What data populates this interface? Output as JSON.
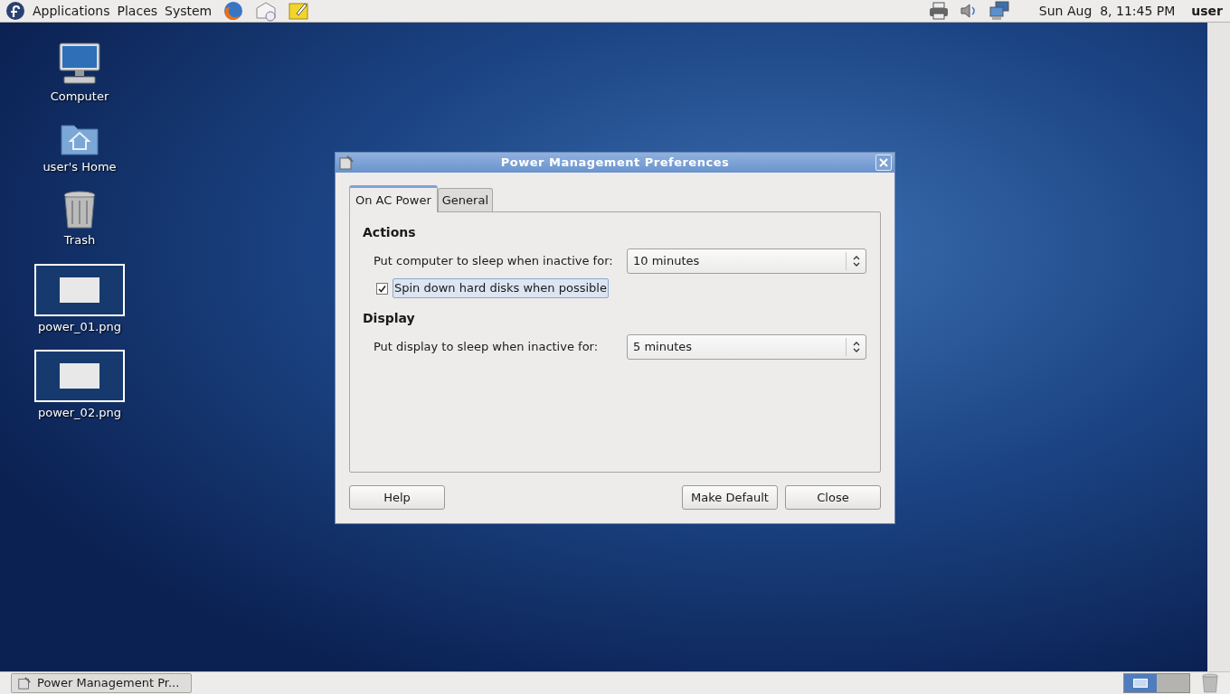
{
  "top_panel": {
    "menus": [
      "Applications",
      "Places",
      "System"
    ],
    "clock": "Sun Aug  8, 11:45 PM",
    "user": "user"
  },
  "desktop_icons": [
    {
      "kind": "computer",
      "label": "Computer"
    },
    {
      "kind": "home",
      "label": "user's Home"
    },
    {
      "kind": "trash",
      "label": "Trash"
    },
    {
      "kind": "image",
      "label": "power_01.png"
    },
    {
      "kind": "image",
      "label": "power_02.png"
    }
  ],
  "dialog": {
    "title": "Power Management Preferences",
    "tabs": [
      {
        "label": "On AC Power",
        "selected": true
      },
      {
        "label": "General",
        "selected": false
      }
    ],
    "sections": [
      {
        "heading": "Actions",
        "rows": [
          {
            "kind": "combo",
            "label": "Put computer to sleep when inactive for:",
            "value": "10 minutes"
          },
          {
            "kind": "check",
            "label": "Spin down hard disks when possible",
            "checked": true,
            "focused": true
          }
        ]
      },
      {
        "heading": "Display",
        "rows": [
          {
            "kind": "combo",
            "label": "Put display to sleep when inactive for:",
            "value": "5 minutes"
          }
        ]
      }
    ],
    "buttons": [
      "Help",
      "Make Default",
      "Close"
    ]
  },
  "taskbar": {
    "tasks": [
      "Power Management Pr..."
    ],
    "workspaces": [
      {
        "selected": true
      },
      {
        "selected": false
      }
    ]
  }
}
